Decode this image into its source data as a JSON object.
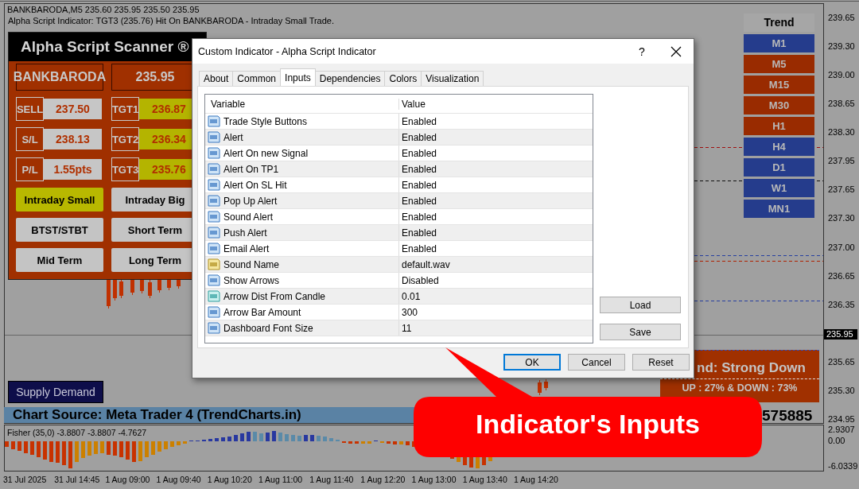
{
  "chart_header": {
    "symbol_line": "BANKBARODA,M5  235.60 235.95 235.50 235.95",
    "alert_line": "Alpha Script Indicator: TGT3 (235.76) Hit On BANKBARODA - Intraday Small Trade."
  },
  "scanner": {
    "title": "Alpha Script Scanner ®",
    "symbol": "BANKBARODA",
    "price": "235.95",
    "levels": [
      {
        "label": "SELL",
        "value": "237.50"
      },
      {
        "label": "S/L",
        "value": "238.13"
      },
      {
        "label": "P/L",
        "value": "1.55pts"
      }
    ],
    "targets": [
      {
        "label": "TGT1",
        "value": "236.87"
      },
      {
        "label": "TGT2",
        "value": "236.34"
      },
      {
        "label": "TGT3",
        "value": "235.76"
      }
    ],
    "trade_styles": [
      {
        "label": "Intraday Small",
        "selected": true
      },
      {
        "label": "Intraday Big",
        "selected": false
      },
      {
        "label": "BTST/STBT",
        "selected": false
      },
      {
        "label": "Short Term",
        "selected": false
      },
      {
        "label": "Mid Term",
        "selected": false
      },
      {
        "label": "Long Term",
        "selected": false
      }
    ]
  },
  "trend_panel": {
    "title": "Trend",
    "timeframes": [
      {
        "label": "M1",
        "color": "#253c8c"
      },
      {
        "label": "M5",
        "color": "#992b00"
      },
      {
        "label": "M15",
        "color": "#992b00"
      },
      {
        "label": "M30",
        "color": "#992b00"
      },
      {
        "label": "H1",
        "color": "#992b00"
      },
      {
        "label": "H4",
        "color": "#253c8c"
      },
      {
        "label": "D1",
        "color": "#253c8c"
      },
      {
        "label": "W1",
        "color": "#253c8c"
      },
      {
        "label": "MN1",
        "color": "#253c8c"
      }
    ]
  },
  "trend_box": {
    "heading": "nd: Strong Down",
    "ratio": "UP : 27% & DOWN : 73%"
  },
  "supply_demand_button": "Supply Demand",
  "source_banner": "Chart Source: Meta Trader 4 (TrendCharts.in)",
  "counter": "575885",
  "price_axis": {
    "labels": [
      "239.65",
      "239.30",
      "239.00",
      "238.65",
      "238.30",
      "237.95",
      "237.65",
      "237.30",
      "237.00",
      "236.65",
      "236.35",
      "235.65",
      "235.30",
      "234.95"
    ],
    "current": "235.95"
  },
  "indicator": {
    "label": "Fisher (35,0) -3.8807 -3.8807 -4.7627",
    "axis_labels": [
      "2.9307",
      "0.00",
      "-6.0339"
    ]
  },
  "time_axis": [
    "31 Jul 2025",
    "31 Jul 14:45",
    "1 Aug 09:00",
    "1 Aug 09:40",
    "1 Aug 10:20",
    "1 Aug 11:00",
    "1 Aug 11:40",
    "1 Aug 12:20",
    "1 Aug 13:00",
    "1 Aug 13:40",
    "1 Aug 14:20"
  ],
  "dialog": {
    "title": "Custom Indicator - Alpha Script Indicator",
    "help": "?",
    "tabs": [
      {
        "label": "About",
        "selected": false
      },
      {
        "label": "Common",
        "selected": false
      },
      {
        "label": "Inputs",
        "selected": true
      },
      {
        "label": "Dependencies",
        "selected": false
      },
      {
        "label": "Colors",
        "selected": false
      },
      {
        "label": "Visualization",
        "selected": false
      }
    ],
    "columns": [
      "Variable",
      "Value"
    ],
    "parameters": [
      {
        "kind": "integer",
        "variable": "Trade Style Buttons",
        "value": "Enabled"
      },
      {
        "kind": "integer",
        "variable": "Alert",
        "value": "Enabled"
      },
      {
        "kind": "integer",
        "variable": "Alert On new Signal",
        "value": "Enabled"
      },
      {
        "kind": "integer",
        "variable": "Alert On TP1",
        "value": "Enabled"
      },
      {
        "kind": "integer",
        "variable": "Alert On SL Hit",
        "value": "Enabled"
      },
      {
        "kind": "integer",
        "variable": "Pop Up Alert",
        "value": "Enabled"
      },
      {
        "kind": "integer",
        "variable": "Sound Alert",
        "value": "Enabled"
      },
      {
        "kind": "integer",
        "variable": "Push Alert",
        "value": "Enabled"
      },
      {
        "kind": "integer",
        "variable": "Email Alert",
        "value": "Enabled"
      },
      {
        "kind": "string",
        "variable": "Sound Name",
        "value": "default.wav"
      },
      {
        "kind": "integer",
        "variable": "Show Arrows",
        "value": "Disabled"
      },
      {
        "kind": "double",
        "variable": "Arrow Dist From Candle",
        "value": "0.01"
      },
      {
        "kind": "integer",
        "variable": "Arrow Bar Amount",
        "value": "300"
      },
      {
        "kind": "integer",
        "variable": "Dashboard Font Size",
        "value": "11"
      }
    ],
    "side_buttons": [
      "Load",
      "Save"
    ],
    "buttons": [
      {
        "label": "OK",
        "default": true
      },
      {
        "label": "Cancel",
        "default": false
      },
      {
        "label": "Reset",
        "default": false
      }
    ]
  },
  "callout": "Indicator's Inputs"
}
